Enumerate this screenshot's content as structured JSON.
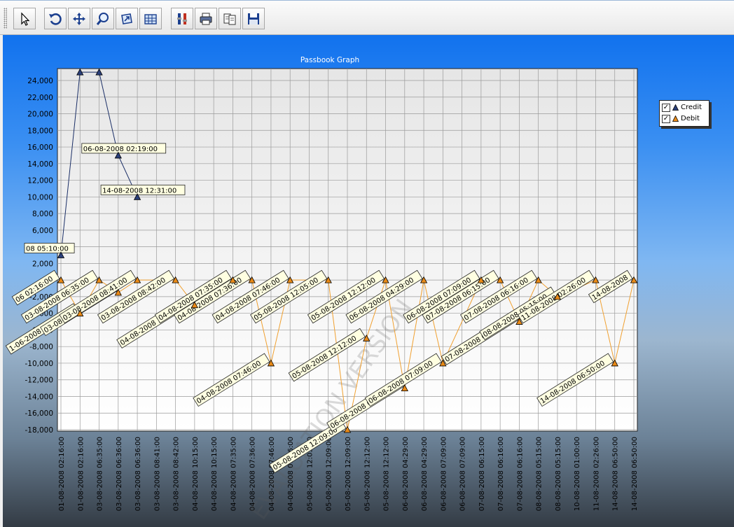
{
  "toolbar": {
    "buttons": [
      {
        "name": "pointer-button",
        "icon": "cursor-arrow-icon"
      },
      {
        "name": "undo-zoom-button",
        "icon": "undo-arrow-icon"
      },
      {
        "name": "pan-button",
        "icon": "move-arrows-icon"
      },
      {
        "name": "zoom-button",
        "icon": "magnifier-icon"
      },
      {
        "name": "zoom-window-button",
        "icon": "zoom-window-icon"
      },
      {
        "name": "chart-editor-button",
        "icon": "chart-grid-icon"
      },
      {
        "name": "properties-button",
        "icon": "tools-icon"
      },
      {
        "name": "print-button",
        "icon": "printer-icon"
      },
      {
        "name": "copy-button",
        "icon": "copy-pages-icon"
      },
      {
        "name": "save-button",
        "icon": "floppy-disk-icon"
      }
    ]
  },
  "watermark": "EVALUATION VERSION",
  "legend": {
    "items": [
      {
        "label": "Credit",
        "checked": "✓",
        "color": "#1a2e66"
      },
      {
        "label": "Debit",
        "checked": "✓",
        "color": "#e98a17"
      }
    ]
  },
  "chart_data": {
    "type": "line",
    "title": "Passbook Graph",
    "xlabel": "",
    "ylabel": "",
    "ylim": [
      -18000,
      25000
    ],
    "yticks": [
      24000,
      22000,
      20000,
      18000,
      16000,
      14000,
      12000,
      10000,
      8000,
      6000,
      4000,
      2000,
      0,
      -2000,
      -4000,
      -6000,
      -8000,
      -10000,
      -12000,
      -14000,
      -16000,
      -18000
    ],
    "ytick_labels": [
      "24,000",
      "22,000",
      "20,000",
      "18,000",
      "16,000",
      "14,000",
      "12,000",
      "10,000",
      "8,000",
      "6,000",
      "4,000",
      "2,000",
      "0",
      "-2,000",
      "-4,000",
      "-6,000",
      "-8,000",
      "-10,000",
      "-12,000",
      "-14,000",
      "-16,000",
      "-18,000"
    ],
    "categories": [
      "01-08-2008 02:16:00",
      "01-08-2008 02:16:00",
      "03-08-2008 06:35:00",
      "03-08-2008 06:36:00",
      "03-08-2008 06:36:00",
      "03-08-2008 08:41:00",
      "03-08-2008 08:42:00",
      "04-08-2008 10:15:00",
      "04-08-2008 10:15:00",
      "04-08-2008 07:35:00",
      "04-08-2008 07:36:00",
      "04-08-2008 07:46:00",
      "04-08-2008 07:46:00",
      "05-08-2008 12:05:00",
      "05-08-2008 12:09:00",
      "05-08-2008 12:09:00",
      "05-08-2008 12:12:00",
      "05-08-2008 12:12:00",
      "06-08-2008 04:29:00",
      "06-08-2008 04:29:00",
      "06-08-2008 07:09:00",
      "06-08-2008 07:09:00",
      "07-08-2008 06:15:00",
      "07-08-2008 06:16:00",
      "07-08-2008 06:16:00",
      "08-08-2008 05:15:00",
      "08-08-2008 05:15:00",
      "10-08-2008 01:00:00",
      "11-08-2008 02:26:00",
      "14-08-2008 06:50:00",
      "14-08-2008 06:50:00"
    ],
    "grid": true,
    "legend_position": "right",
    "series": [
      {
        "name": "Credit",
        "color": "#1a2e66",
        "marker_color": "#2a3f7a",
        "points": [
          {
            "i": 0,
            "y": 3000,
            "label": "08 05:10:00"
          },
          {
            "i": 1,
            "y": 25000
          },
          {
            "i": 2,
            "y": 25000
          },
          {
            "i": 3,
            "y": 15000,
            "label": "06-08-2008 02:19:00"
          },
          {
            "i": 4,
            "y": 10000,
            "label": "14-08-2008 12:31:00"
          }
        ]
      },
      {
        "name": "Debit",
        "color": "#f0a030",
        "marker_color": "#e98a17",
        "points": [
          {
            "i": 0,
            "y": 0,
            "label": "06 02:16:00"
          },
          {
            "i": 1,
            "y": -4000,
            "label": "1-06-2008 02:15:00"
          },
          {
            "i": 2,
            "y": 0,
            "label": "03-08-2008 06:35:00"
          },
          {
            "i": 3,
            "y": -1500,
            "label": "03-08-2008 06:36:00"
          },
          {
            "i": 4,
            "y": 0,
            "label": "03-08-2008 08:41:00"
          },
          {
            "i": 6,
            "y": 0,
            "label": "03-08-2008 08:42:00"
          },
          {
            "i": 7,
            "y": -3000,
            "label": "04-08-2008 10:15:00"
          },
          {
            "i": 9,
            "y": 0,
            "label": "04-08-2008 07:35:00"
          },
          {
            "i": 10,
            "y": 0,
            "label": "04-08-2008 07:36:00"
          },
          {
            "i": 11,
            "y": -10000,
            "label": "04-08-2008 07:46:00"
          },
          {
            "i": 12,
            "y": 0,
            "label": "04-08-2008 07:46:00"
          },
          {
            "i": 14,
            "y": 0,
            "label": "05-08-2008 12:05:00"
          },
          {
            "i": 15,
            "y": -18000,
            "label": "05-08-2008 12:09:00"
          },
          {
            "i": 16,
            "y": -7000,
            "label": "05-08-2008 12:12:00"
          },
          {
            "i": 17,
            "y": 0,
            "label": "05-08-2008 12:12:00"
          },
          {
            "i": 18,
            "y": -13000,
            "label": "06-08-2008 04:29:00"
          },
          {
            "i": 19,
            "y": 0,
            "label": "06-08-2008 04:29:00"
          },
          {
            "i": 20,
            "y": -10000,
            "label": "06-08-2008 07:09:00"
          },
          {
            "i": 22,
            "y": 0,
            "label": "06-08-2008 07:09:00"
          },
          {
            "i": 23,
            "y": 0,
            "label": "07-08-2008 06:15:00"
          },
          {
            "i": 24,
            "y": -5000,
            "label": "07-08-2008 06:16:00"
          },
          {
            "i": 25,
            "y": 0,
            "label": "07-08-2008 06:16:00"
          },
          {
            "i": 26,
            "y": -2000,
            "label": "08-08-2008 05:15:00"
          },
          {
            "i": 28,
            "y": 0,
            "label": "11-08-2008 02:26:00"
          },
          {
            "i": 29,
            "y": -10000,
            "label": "14-08-2008 06:50:00"
          },
          {
            "i": 30,
            "y": 0,
            "label": "14-08-2008"
          }
        ]
      }
    ]
  }
}
